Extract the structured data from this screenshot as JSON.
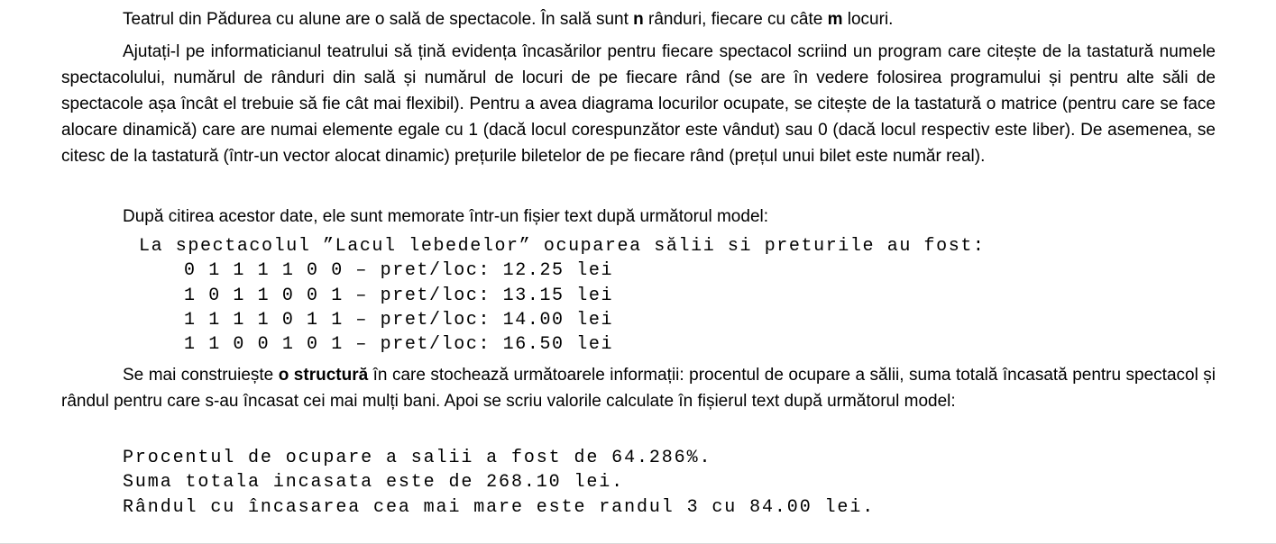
{
  "paragraphs": {
    "p1": {
      "before_n": "Teatrul din Pădurea cu alune are o sală de spectacole. În sală sunt ",
      "n": "n",
      "between": " rânduri, fiecare cu câte ",
      "m": "m",
      "after_m": " locuri."
    },
    "p2": "Ajutați-l pe informaticianul teatrului să țină evidența încasărilor pentru fiecare spectacol scriind un program care citește de la tastatură numele spectacolului, numărul de rânduri din sală și numărul de locuri de pe fiecare rând (se are în vedere folosirea programului și pentru alte săli de spectacole așa încât el trebuie să fie cât mai flexibil). Pentru a avea diagrama locurilor ocupate, se citește de la tastatură o matrice (pentru care se face alocare dinamică) care are numai elemente egale cu 1 (dacă locul corespunzător este vândut) sau 0 (dacă locul respectiv este liber). De asemenea, se citesc de la tastatură (într-un vector alocat dinamic) prețurile biletelor de pe fiecare rând (prețul unui bilet este număr real).",
    "p3": "După citirea acestor date, ele sunt memorate într-un fișier text după următorul model:",
    "p4": {
      "before_bold": "Se mai construiește ",
      "bold": "o structură",
      "after_bold": " în care stochează următoarele informații: procentul de ocupare a sălii, suma totală încasată pentru spectacol și rândul pentru care s-au încasat cei mai mulți bani. Apoi se scriu valorile calculate în fișierul text după următorul model:"
    }
  },
  "example_file": {
    "header": "La spectacolul ”Lacul lebedelor” ocuparea sălii si preturile au fost:",
    "rows": [
      "0 1 1 1 1 0 0 – pret/loc: 12.25 lei",
      "1 0 1 1 0 0 1 – pret/loc: 13.15 lei",
      "1 1 1 1 0 1 1 – pret/loc: 14.00 lei",
      "1 1 0 0 1 0 1 – pret/loc: 16.50 lei"
    ]
  },
  "example_output": {
    "lines": [
      "Procentul de ocupare a salii a fost de 64.286%.",
      "Suma totala incasata este de 268.10 lei.",
      "Rândul cu încasarea cea mai mare este randul 3 cu 84.00 lei."
    ]
  }
}
